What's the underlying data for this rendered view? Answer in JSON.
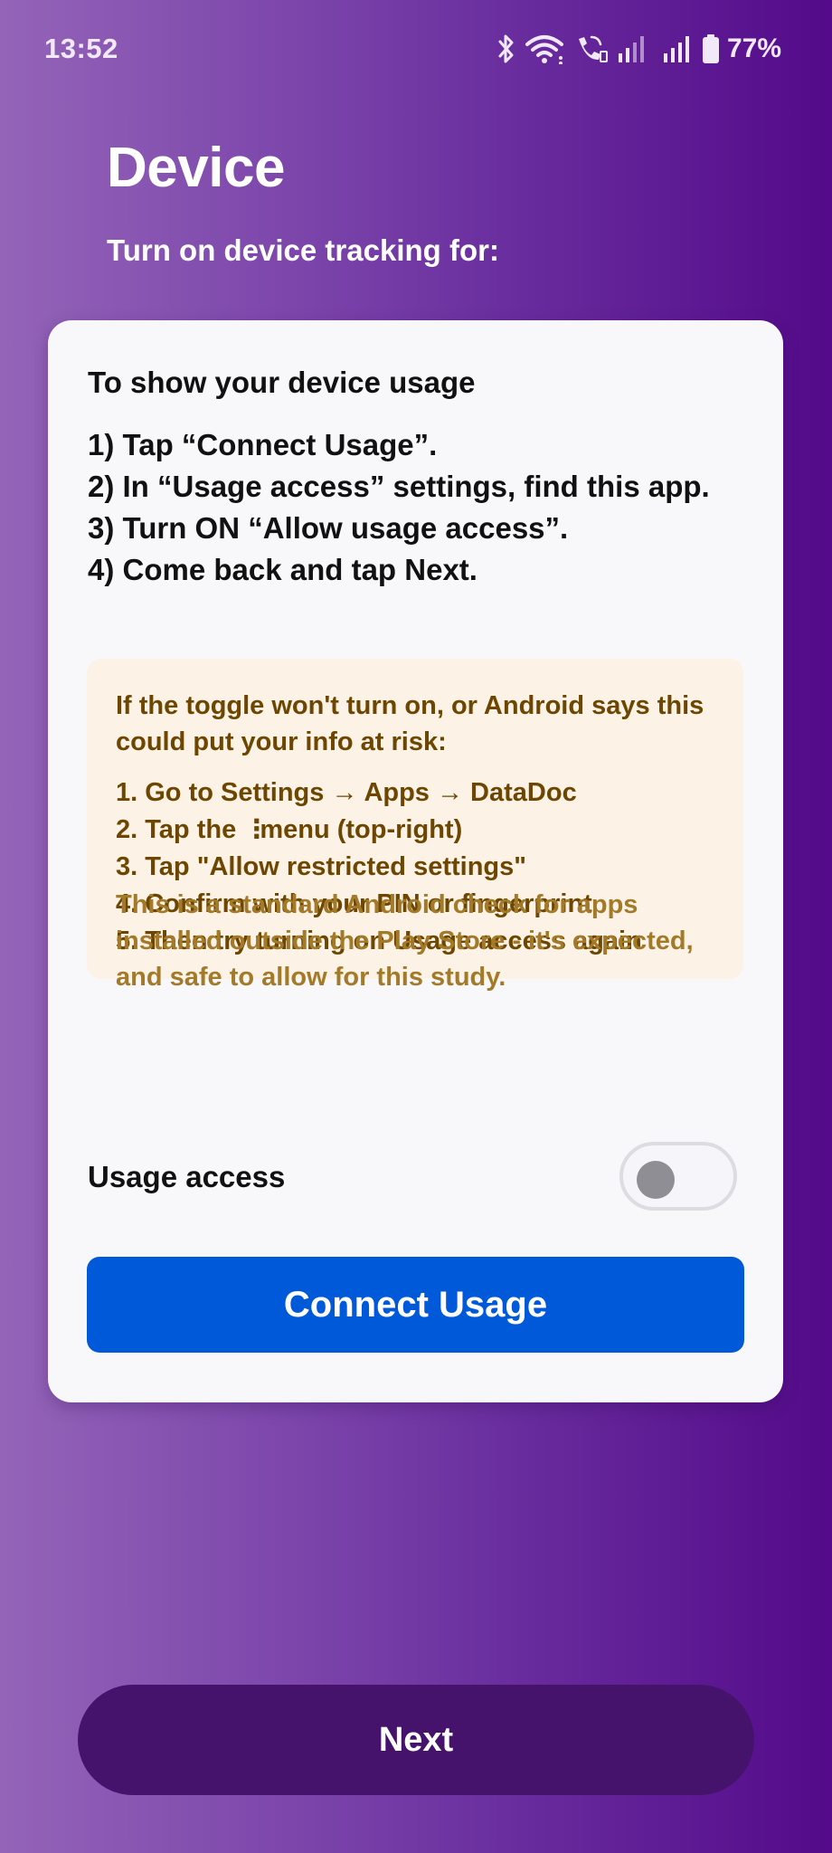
{
  "status_bar": {
    "time": "13:52",
    "battery_percent": "77%",
    "icons": [
      "bluetooth-icon",
      "wifi-icon",
      "wifi-calling-icon",
      "signal-icon",
      "signal-icon",
      "battery-icon"
    ]
  },
  "header": {
    "title": "Device",
    "subtitle": "Turn on device tracking for:"
  },
  "card": {
    "heading": "To show your device usage",
    "steps": [
      "1) Tap “Connect Usage”.",
      "2) In “Usage access” settings, find this app.",
      "3) Turn ON “Allow usage access”.",
      "4) Come back and tap Next."
    ],
    "warning": {
      "title": "If the toggle won't turn on, or Android says this could put your info at risk:",
      "steps": [
        "1. Go to Settings → Apps → DataDoc",
        "2. Tap the",
        "menu (top-right)",
        "3. Tap \"Allow restricted settings\"",
        "4. Confirm with your PIN or fingerprint",
        "5. Then try turning on Usage access again"
      ],
      "kebab_glyph": "⋮",
      "note": "This is a standard Android check for apps installed outside the Play Store - it's expected, and safe to allow for this study."
    },
    "toggle": {
      "label": "Usage access",
      "checked": false
    },
    "connect_button_label": "Connect Usage"
  },
  "footer": {
    "next_button_label": "Next"
  },
  "colors": {
    "background_start": "#9464b8",
    "background_end": "#540a8a",
    "card": "#f8f8fa",
    "primary_button": "#0059d9",
    "next_button": "#45136c",
    "warning_bg": "#fdf2e6",
    "warning_text": "#6d4602",
    "warning_note": "#a37a29"
  }
}
